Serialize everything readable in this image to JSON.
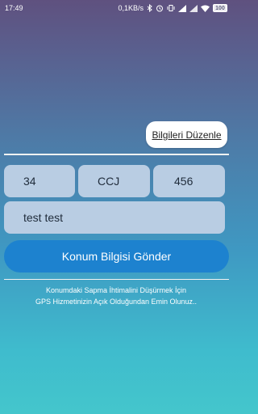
{
  "status_bar": {
    "time": "17:49",
    "network_speed": "0,1KB/s",
    "battery": "100",
    "icons": [
      "bluetooth-icon",
      "alarm-icon",
      "vibrate-icon",
      "signal-icon",
      "signal-icon",
      "wifi-icon",
      "battery-icon"
    ]
  },
  "edit_button": {
    "label": "Bilgileri Düzenle"
  },
  "fields": {
    "field1": "34",
    "field2": "CCJ",
    "field3": "456",
    "name": "test test"
  },
  "send_button": {
    "label": "Konum Bilgisi Gönder"
  },
  "info": {
    "line1": "Konumdaki Sapma İhtimalini Düşürmek İçin",
    "line2": "GPS Hizmetinizin Açık Olduğundan Emin Olunuz.."
  },
  "colors": {
    "gradient_top": "#5f517f",
    "gradient_bottom": "#44c6cc",
    "field_bg": "#b9cde3",
    "send_button_bg": "#1d82cf"
  }
}
